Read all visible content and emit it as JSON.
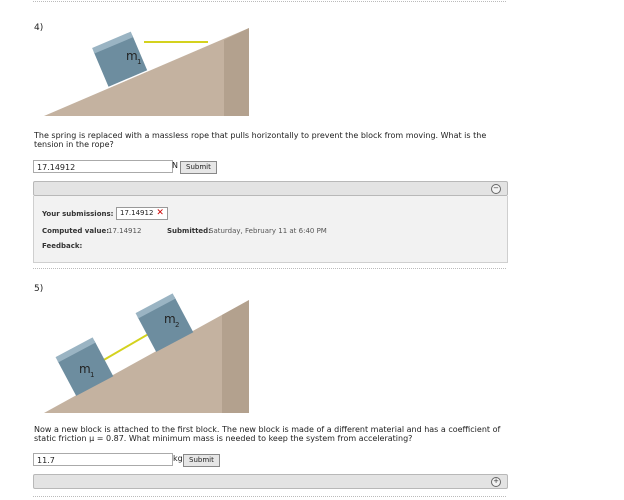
{
  "q4": {
    "number": "4)",
    "block_label": "m",
    "block_sub": "1",
    "question": "The spring is replaced with a massless rope that pulls horizontally to prevent the block from moving. What is the tension in the rope?",
    "answer": "17.14912",
    "unit": "N",
    "submit": "Submit",
    "panel": {
      "toggle": "−",
      "submissions_label": "Your submissions:",
      "submission_value": "17.14912",
      "submission_mark": "✕",
      "computed_label": "Computed value:",
      "computed_value": "17.14912",
      "submitted_label": "Submitted:",
      "submitted_value": "Saturday, February 11 at 6:40 PM",
      "feedback_label": "Feedback:"
    }
  },
  "q5": {
    "number": "5)",
    "block1_label": "m",
    "block1_sub": "1",
    "block2_label": "m",
    "block2_sub": "2",
    "question": "Now a new block is attached to the first block. The new block is made of a different material and has a coefficient of static friction μ = 0.87. What minimum mass is needed to keep the system from accelerating?",
    "answer": "11.7",
    "unit": "kg",
    "submit": "Submit",
    "panel": {
      "toggle": "+"
    }
  },
  "colors": {
    "incline_top": "#c4b2a0",
    "incline_side": "#a08d79",
    "block": "#7392a3",
    "rope": "#d4d21e"
  }
}
